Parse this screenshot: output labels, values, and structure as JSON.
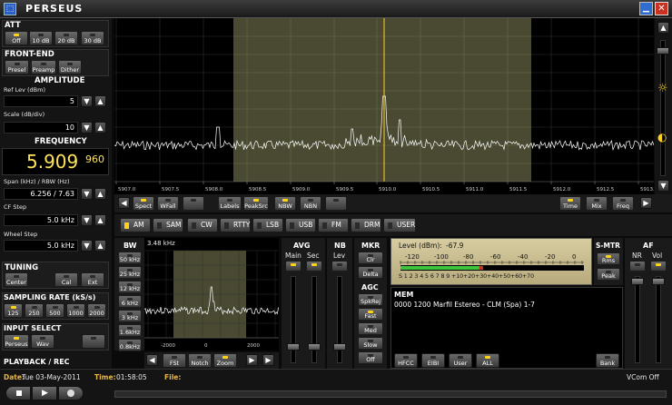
{
  "app": {
    "title": "PERSEUS"
  },
  "att": {
    "label": "ATT",
    "buttons": [
      "Off",
      "10 dB",
      "20 dB",
      "30 dB"
    ]
  },
  "frontend": {
    "label": "FRONT-END",
    "buttons": [
      "Presel",
      "Preamp",
      "Dither"
    ]
  },
  "amplitude": {
    "label": "AMPLITUDE",
    "ref_label": "Ref Lev (dBm)",
    "ref_value": "5",
    "scale_label": "Scale (dB/div)",
    "scale_value": "10"
  },
  "frequency": {
    "label": "FREQUENCY",
    "main": "5.909",
    "sub": "960",
    "span_label": "Span (kHz) / RBW (Hz)",
    "span_value": "6.256 / 7.63",
    "cf_label": "CF Step",
    "cf_value": "5.0 kHz",
    "wheel_label": "Wheel Step",
    "wheel_value": "5.0 kHz"
  },
  "tuning": {
    "label": "TUNING",
    "buttons": [
      "Center",
      "Cal",
      "Ext"
    ]
  },
  "sampling": {
    "label": "SAMPLING RATE (kS/s)",
    "buttons": [
      "125",
      "250",
      "500",
      "1000",
      "2000"
    ]
  },
  "input": {
    "label": "INPUT SELECT",
    "buttons": [
      "Perseus",
      "Wav"
    ]
  },
  "playback": {
    "label": "PLAYBACK / REC"
  },
  "status": {
    "date_label": "Date:",
    "date": "Tue 03-May-2011",
    "time_label": "Time:",
    "time": "01:58:05",
    "file_label": "File:",
    "vcom": "VCom Off"
  },
  "spectrum": {
    "x_ticks": [
      "5907.0",
      "5907.5",
      "5908.0",
      "5908.5",
      "5909.0",
      "5909.5",
      "5910.0",
      "5910.5",
      "5911.0",
      "5911.5",
      "5912.0",
      "5912.5",
      "5913.0"
    ],
    "toolbar": [
      "Spect",
      "WFall",
      "Labels",
      "PeakSrc",
      "NBW",
      "NBN",
      "Time",
      "Mix",
      "Freq"
    ]
  },
  "modes": [
    "AM",
    "SAM",
    "CW",
    "RTTY",
    "LSB",
    "USB",
    "FM",
    "DRM",
    "USER"
  ],
  "mode_selected": "AM",
  "bw": {
    "label": "BW",
    "value": "3.48 kHz",
    "buttons": [
      "50 kHz",
      "25 kHz",
      "12 kHz",
      "6 kHz",
      "3 kHz",
      "1.6kHz",
      "0.8kHz"
    ],
    "x_ticks": [
      "-2000",
      "0",
      "2000"
    ],
    "toolbar": [
      "FSt",
      "Notch",
      "Zoom"
    ]
  },
  "avg": {
    "label": "AVG",
    "main": "Main",
    "sec": "Sec"
  },
  "nb": {
    "label": "NB",
    "lev": "Lev"
  },
  "mkr": {
    "label": "MKR",
    "buttons": [
      "Clr",
      "Delta"
    ]
  },
  "agc": {
    "label": "AGC",
    "buttons": [
      "SpkRej",
      "Fast",
      "Med",
      "Slow",
      "Off"
    ]
  },
  "meter": {
    "level_label": "Level (dBm):",
    "level": "-67.9",
    "scale_dbm": [
      "-120",
      "-100",
      "-80",
      "-60",
      "-40",
      "-20",
      "0"
    ],
    "scale_s": "S 1  2  3  4  5  6  7  8  9 +10+20+30+40+50+60+70",
    "level_fraction": 0.43
  },
  "smtr": {
    "label": "S-MTR",
    "buttons": [
      "Rms",
      "Peak"
    ]
  },
  "af": {
    "label": "AF",
    "nr": "NR",
    "vol": "Vol"
  },
  "mem": {
    "label": "MEM",
    "entry": "0000 1200 Marfil Estereo  - CLM (Spa)  1-7",
    "buttons": [
      "HFCC",
      "EIBI",
      "User",
      "ALL",
      "Bank"
    ]
  }
}
